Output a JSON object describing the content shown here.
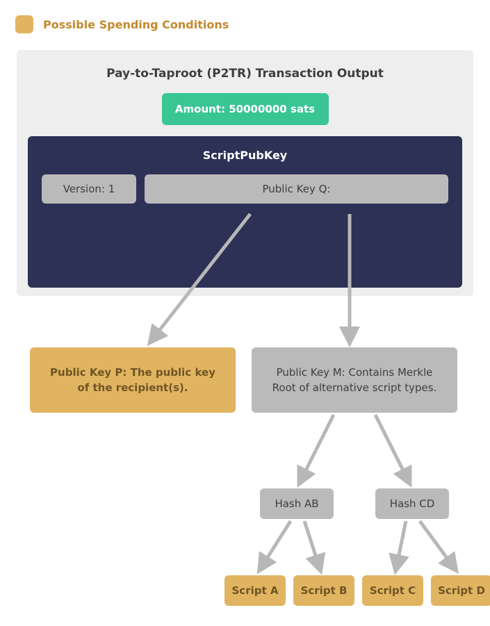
{
  "legend_label": "Possible Spending Conditions",
  "card": {
    "title": "Pay-to-Taproot (P2TR) Transaction Output",
    "amount": "Amount: 50000000 sats",
    "scriptpubkey_label": "ScriptPubKey",
    "version": "Version: 1",
    "pubkey_q": "Public Key Q:"
  },
  "nodes": {
    "pkP": "Public Key P: The public key of the recipient(s).",
    "pkM": "Public Key M: Contains Merkle Root of alternative script types.",
    "hashAB": "Hash AB",
    "hashCD": "Hash CD",
    "scriptA": "Script A",
    "scriptB": "Script B",
    "scriptC": "Script C",
    "scriptD": "Script D"
  },
  "colors": {
    "gold": "#E1B461",
    "navy": "#2C3155",
    "teal": "#39C594",
    "grey": "#BABABA"
  }
}
